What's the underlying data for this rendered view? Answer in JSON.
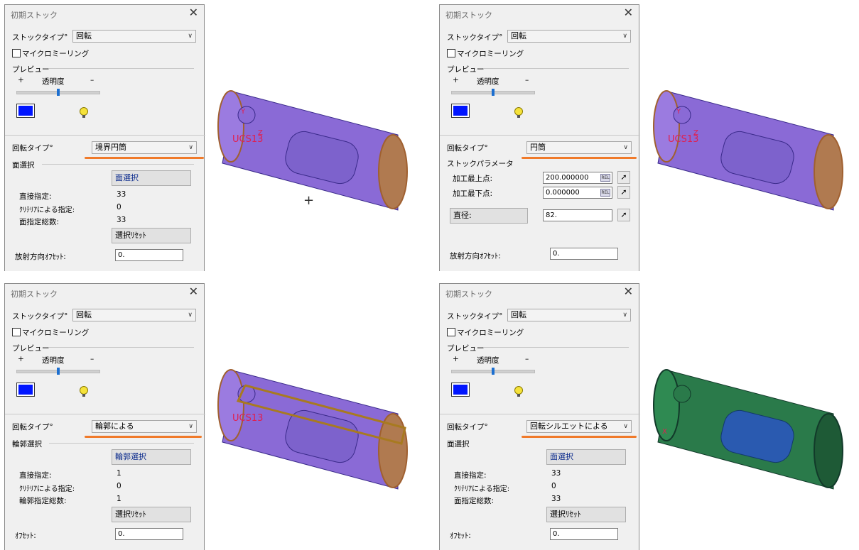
{
  "dialog_title": "初期ストック",
  "close_glyph": "✕",
  "common": {
    "stock_type_label": "ストックタイプ°",
    "stock_type_value": "回転",
    "micro_milling_label": "マイクロミーリング",
    "preview_label": "プレビュー",
    "plus": "+",
    "transparency_label": "透明度",
    "minus": "–",
    "rotation_type_label": "回転タイプ°"
  },
  "panels": [
    {
      "rotation_type_value": "境界円筒",
      "select_label": "面選択",
      "select_button": "面選択",
      "direct_label": "直接指定:",
      "direct_value": "33",
      "criteria_label": "ｸﾘﾃﾘｱによる指定:",
      "criteria_value": "0",
      "total_label": "面指定総数:",
      "total_value": "33",
      "reset_button": "選択ﾘｾｯﾄ",
      "offset_label": "放射方向ｵﾌｾｯﾄ:",
      "offset_value": "0."
    },
    {
      "rotation_type_value": "円筒",
      "stock_param_label": "ストックパラメータ",
      "top_label": "加工最上点:",
      "top_value": "200.000000",
      "bottom_label": "加工最下点:",
      "bottom_value": "0.000000",
      "rel_text": "REL",
      "diameter_label": "直径:",
      "diameter_value": "82.",
      "offset_label": "放射方向ｵﾌｾｯﾄ:",
      "offset_value": "0."
    },
    {
      "rotation_type_value": "輪郭による",
      "select_label": "輪郭選択",
      "select_button": "輪郭選択",
      "direct_label": "直接指定:",
      "direct_value": "1",
      "criteria_label": "ｸﾘﾃﾘｱによる指定:",
      "criteria_value": "0",
      "total_label": "輪郭指定総数:",
      "total_value": "1",
      "reset_button": "選択ﾘｾｯﾄ",
      "offset_label": "ｵﾌｾｯﾄ:",
      "offset_value": "0."
    },
    {
      "rotation_type_value": "回転シルエットによる",
      "select_label": "面選択",
      "select_button": "面選択",
      "direct_label": "直接指定:",
      "direct_value": "33",
      "criteria_label": "ｸﾘﾃﾘｱによる指定:",
      "criteria_value": "0",
      "total_label": "面指定総数:",
      "total_value": "33",
      "reset_button": "選択ﾘｾｯﾄ",
      "offset_label": "ｵﾌｾｯﾄ:",
      "offset_value": "0."
    }
  ],
  "model": {
    "ucs_label": "UCS13",
    "axis_y": "Y",
    "axis_z": "Z",
    "axis_x": "X"
  },
  "colors": {
    "accent_underline": "#f07a2a",
    "preview_color": "#0015ff",
    "stock_purple": "#7a5cc8",
    "stock_green": "#1f6a3a"
  }
}
